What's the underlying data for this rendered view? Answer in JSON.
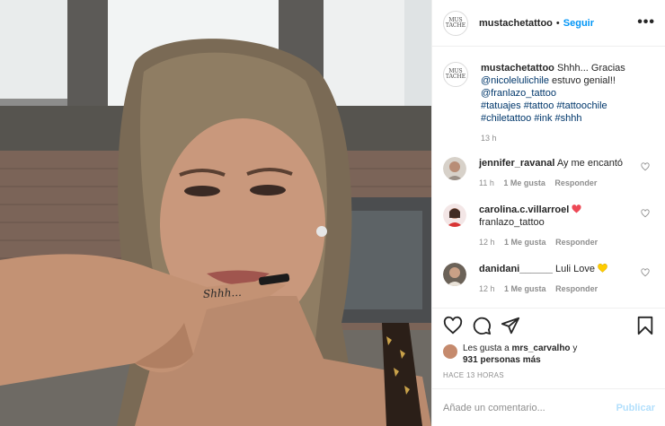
{
  "post": {
    "photo": {
      "finger_tattoo_text": "Shhh..."
    },
    "header": {
      "logo_text": "MUS TACHE",
      "username": "mustachetattoo",
      "separator": "•",
      "follow_label": "Seguir",
      "more_label": "•••"
    },
    "caption": {
      "username": "mustachetattoo",
      "text_intro": "Shhh... Gracias",
      "mention_1": "@nicolelulichile",
      "text_after_mention": "estuvo genial!!",
      "mention_2": "@franlazo_tattoo",
      "hashtags_line_1": "#tatuajes #tattoo #tattoochile",
      "hashtags_line_2": "#chiletattoo #ink #shhh",
      "time": "13 h"
    },
    "comments": [
      {
        "username": "jennifer_ravanal",
        "text": "Ay me encantó",
        "time": "11 h",
        "likes": "1 Me gusta",
        "reply": "Responder"
      },
      {
        "username": "carolina.c.villarroel",
        "text": "franlazo_tattoo",
        "time": "12 h",
        "likes": "1 Me gusta",
        "reply": "Responder"
      },
      {
        "username": "danidani______",
        "text": "Luli Love",
        "time": "12 h",
        "likes": "1 Me gusta",
        "reply": "Responder"
      }
    ],
    "likes": {
      "prefix": "Les gusta a",
      "user": "mrs_carvalho",
      "middle": "y",
      "count": "931 personas más"
    },
    "timestamp": "HACE 13 HORAS",
    "add_comment": {
      "placeholder": "Añade un comentario...",
      "publish_label": "Publicar"
    },
    "colors": {
      "link": "#00376b",
      "follow": "#0095f6",
      "publish_disabled": "#b2dffc",
      "meta_gray": "#8e8e8e",
      "red_heart": "#ed4956",
      "yellow_heart": "#ffcc00"
    }
  }
}
